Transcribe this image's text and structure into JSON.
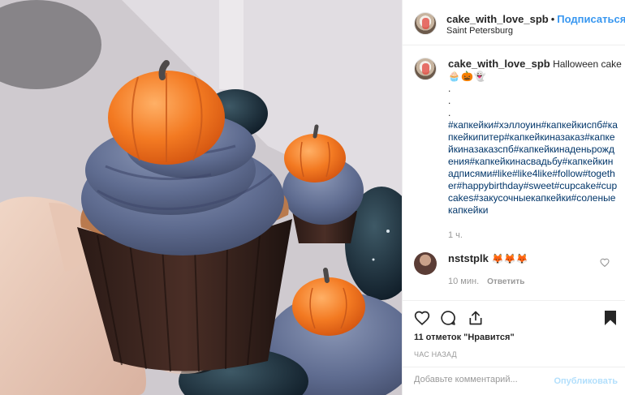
{
  "post": {
    "author": "cake_with_love_spb",
    "follow_label": "Подписаться",
    "separator": "•",
    "location": "Saint Petersburg",
    "caption_title": "Halloween cake",
    "caption_emojis": "🧁🎃👻",
    "caption_dots": ".",
    "caption_hashtags": "#капкейки#хэллоуин#капкейкиспб#капкейкипитер#капкейкиназаказ#капкейкиназаказспб#капкейкинаденьрождения#капкейкинасвадьбу#капкейкинадписями#like#like4like#follow#together#happybirthday#sweet#cupcake#cupcakes#закусочныекапкейки#соленыекапкейки",
    "caption_time": "1 ч."
  },
  "comment": {
    "user": "nststplk",
    "text": "🦊🦊🦊",
    "time": "10 мин.",
    "reply_label": "Ответить"
  },
  "actions": {
    "likes": "11 отметок \"Нравится\"",
    "time_ago": "ЧАС НАЗАД"
  },
  "add_comment": {
    "placeholder": "Добавьте комментарий...",
    "publish_label": "Опубликовать"
  },
  "colors": {
    "link_blue": "#3897f0",
    "hashtag_blue": "#003569",
    "publish_disabled": "#b2dffc",
    "frosting": "#5f6e92",
    "pumpkin": "#f37021"
  }
}
